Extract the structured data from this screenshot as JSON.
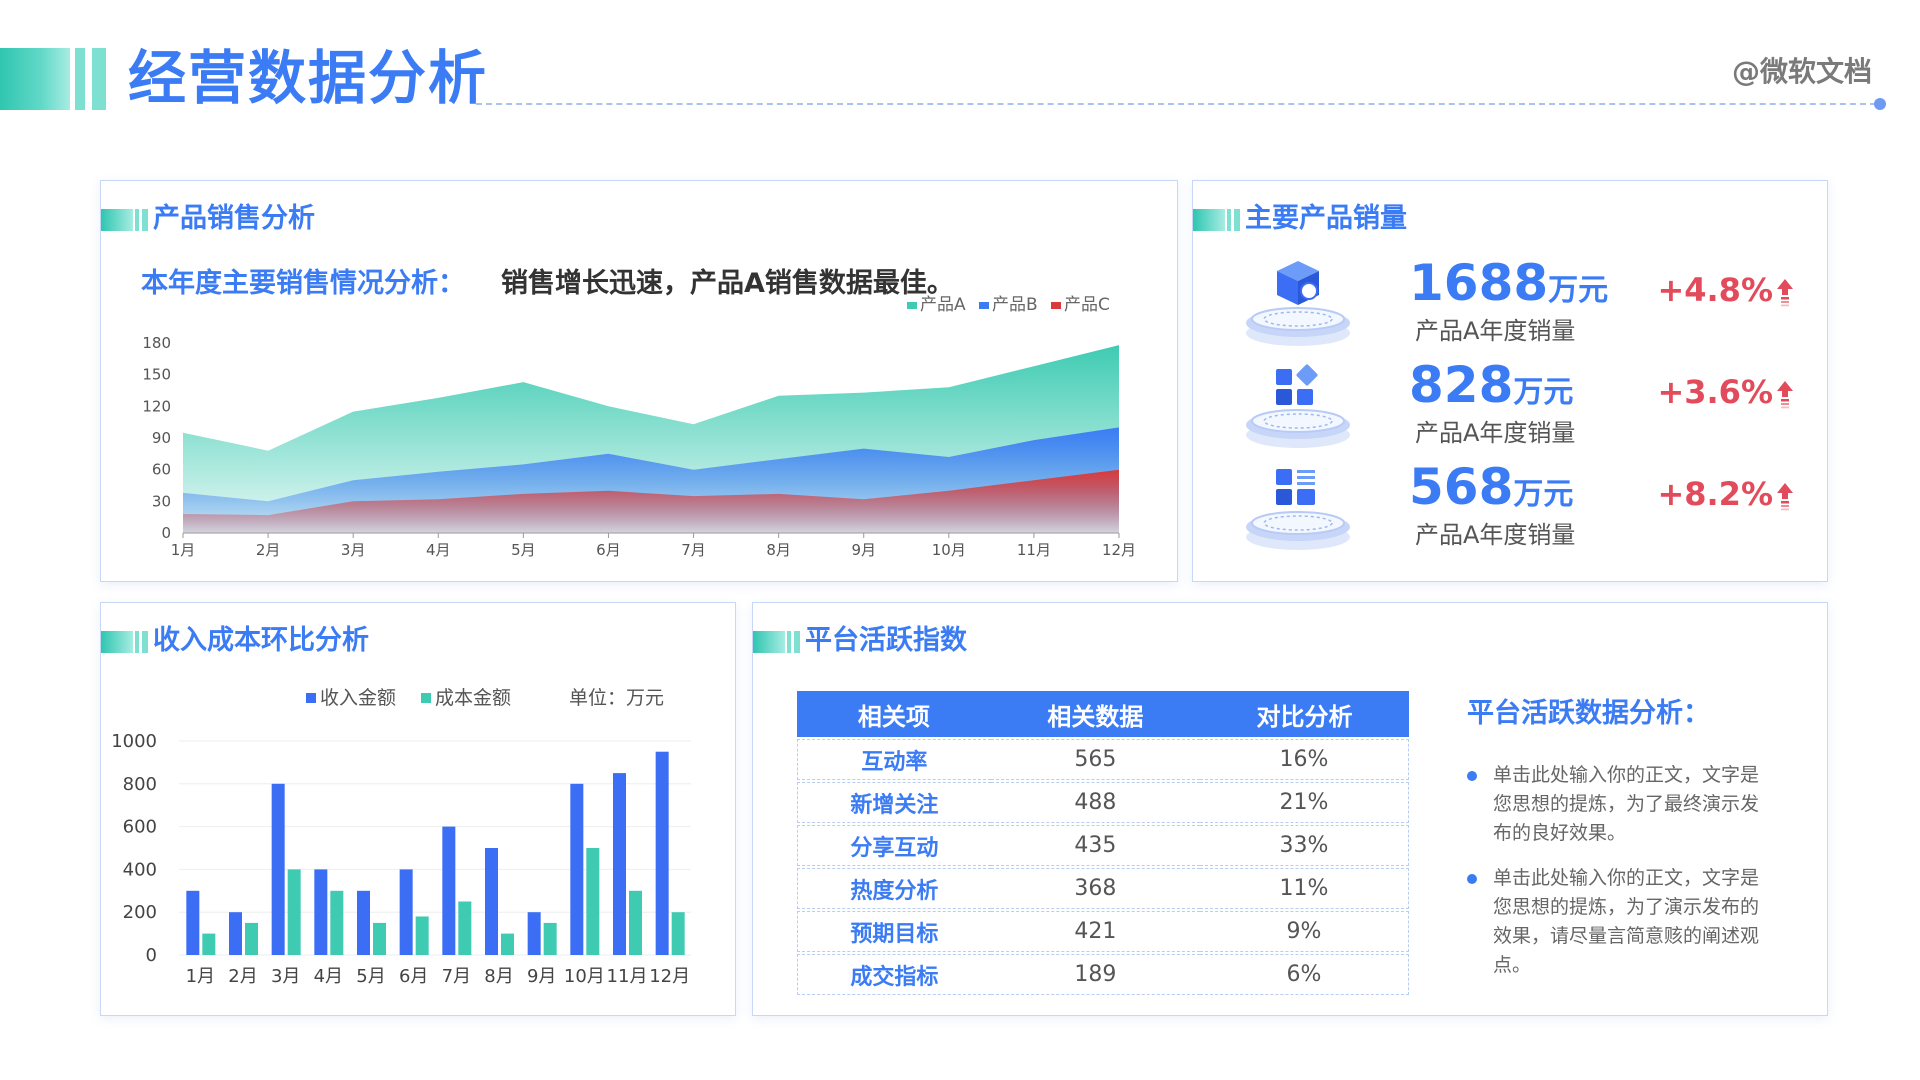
{
  "header": {
    "title": "经营数据分析",
    "brand": "@微软文档"
  },
  "sales_panel": {
    "title": "产品销售分析",
    "headline": "本年度主要销售情况分析：",
    "note": "销售增长迅速，产品A销售数据最佳。"
  },
  "main_products": {
    "title": "主要产品销量",
    "items": [
      {
        "value": "1688",
        "unit": "万元",
        "label": "产品A年度销量",
        "change": "+4.8%",
        "icon": "cube-icon"
      },
      {
        "value": "828",
        "unit": "万元",
        "label": "产品A年度销量",
        "change": "+3.6%",
        "icon": "blocks-icon"
      },
      {
        "value": "568",
        "unit": "万元",
        "label": "产品A年度销量",
        "change": "+8.2%",
        "icon": "grid-list-icon"
      }
    ]
  },
  "revenue_panel": {
    "title": "收入成本环比分析",
    "unit_note": "单位：万元"
  },
  "activity_panel": {
    "title": "平台活跃指数",
    "table": {
      "headers": [
        "相关项",
        "相关数据",
        "对比分析"
      ],
      "rows": [
        [
          "互动率",
          "565",
          "16%"
        ],
        [
          "新增关注",
          "488",
          "21%"
        ],
        [
          "分享互动",
          "435",
          "33%"
        ],
        [
          "热度分析",
          "368",
          "11%"
        ],
        [
          "预期目标",
          "421",
          "9%"
        ],
        [
          "成交指标",
          "189",
          "6%"
        ]
      ]
    },
    "analysis_title": "平台活跃数据分析：",
    "bullets": [
      "单击此处输入你的正文，文字是您思想的提炼，为了最终演示发布的良好效果。",
      "单击此处输入你的正文，文字是您思想的提炼，为了演示发布的效果，请尽量言简意赅的阐述观点。"
    ]
  },
  "colors": {
    "accent": "#3b7cf5",
    "teal": "#2fc6b0",
    "red": "#e24b5b"
  },
  "chart_data": [
    {
      "type": "area",
      "categories": [
        "1月",
        "2月",
        "3月",
        "4月",
        "5月",
        "6月",
        "7月",
        "8月",
        "9月",
        "10月",
        "11月",
        "12月"
      ],
      "series": [
        {
          "name": "产品A",
          "color": "#3ecbb2",
          "values": [
            95,
            78,
            115,
            128,
            143,
            120,
            103,
            130,
            133,
            138,
            158,
            178
          ]
        },
        {
          "name": "产品B",
          "color": "#3b7cf5",
          "values": [
            38,
            30,
            50,
            58,
            65,
            75,
            60,
            70,
            80,
            72,
            88,
            100
          ]
        },
        {
          "name": "产品C",
          "color": "#d93a3a",
          "values": [
            18,
            17,
            30,
            32,
            37,
            40,
            35,
            37,
            32,
            40,
            50,
            60
          ]
        }
      ],
      "ylim": [
        0,
        180
      ],
      "yticks": [
        0,
        30,
        60,
        90,
        120,
        150,
        180
      ],
      "legend": "top-right"
    },
    {
      "type": "bar",
      "categories": [
        "1月",
        "2月",
        "3月",
        "4月",
        "5月",
        "6月",
        "7月",
        "8月",
        "9月",
        "10月",
        "11月",
        "12月"
      ],
      "series": [
        {
          "name": "收入金额",
          "color": "#3b6ef5",
          "values": [
            300,
            200,
            800,
            400,
            300,
            400,
            600,
            500,
            200,
            800,
            850,
            950
          ]
        },
        {
          "name": "成本金额",
          "color": "#3ecbb2",
          "values": [
            100,
            150,
            400,
            300,
            150,
            180,
            250,
            100,
            150,
            500,
            300,
            200
          ]
        }
      ],
      "ylim": [
        0,
        1000
      ],
      "yticks": [
        0,
        200,
        400,
        600,
        800,
        1000
      ],
      "legend": "top-center"
    }
  ]
}
